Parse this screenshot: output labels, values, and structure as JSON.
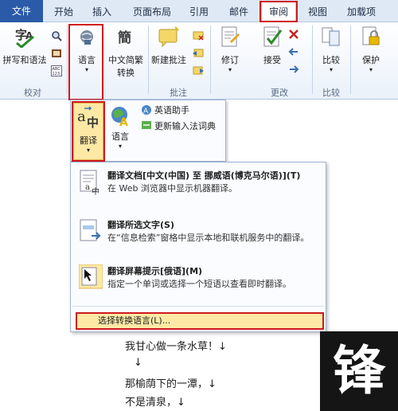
{
  "tabs": [
    {
      "id": "file",
      "label": "文件"
    },
    {
      "id": "home",
      "label": "开始"
    },
    {
      "id": "insert",
      "label": "插入"
    },
    {
      "id": "layout",
      "label": "页面布局"
    },
    {
      "id": "references",
      "label": "引用"
    },
    {
      "id": "mailings",
      "label": "邮件"
    },
    {
      "id": "review",
      "label": "审阅"
    },
    {
      "id": "view",
      "label": "视图"
    },
    {
      "id": "addins",
      "label": "加载项"
    }
  ],
  "ribbon": {
    "spelling_label": "拼写和语法",
    "language_label": "语言",
    "chinese_convert_label": "中文简繁",
    "chinese_convert_sub": "转换",
    "new_comment_label": "新建批注",
    "track_label": "修订",
    "accept_label": "接受",
    "compare_label": "比较",
    "protect_label": "保护",
    "groups": {
      "proofing": "校对",
      "comments": "批注",
      "changes": "更改",
      "compare": "比较"
    }
  },
  "language_menu": {
    "translate_label": "翻译",
    "language_label": "语言",
    "english_assistant": "英语助手",
    "update_ime": "更新输入法词典"
  },
  "translate_menu": {
    "items": [
      {
        "title": "翻译文档[中文(中国) 至 挪威语(博克马尔语)](T)",
        "desc": "在 Web 浏览器中显示机器翻译。"
      },
      {
        "title": "翻译所选文字(S)",
        "desc": "在“信息检索”窗格中显示本地和联机服务中的翻译。"
      },
      {
        "title": "翻译屏幕提示[俄语](M)",
        "desc": "指定一个单词或选择一个短语以查看即时翻译。"
      }
    ],
    "select_language": "选择转换语言(L)..."
  },
  "document": {
    "lines": [
      "我甘心做一条水草！↓",
      "↓",
      "那榆荫下的一潭，↓",
      "不是清泉，↓"
    ]
  },
  "logo": {
    "glyph": "锋"
  }
}
